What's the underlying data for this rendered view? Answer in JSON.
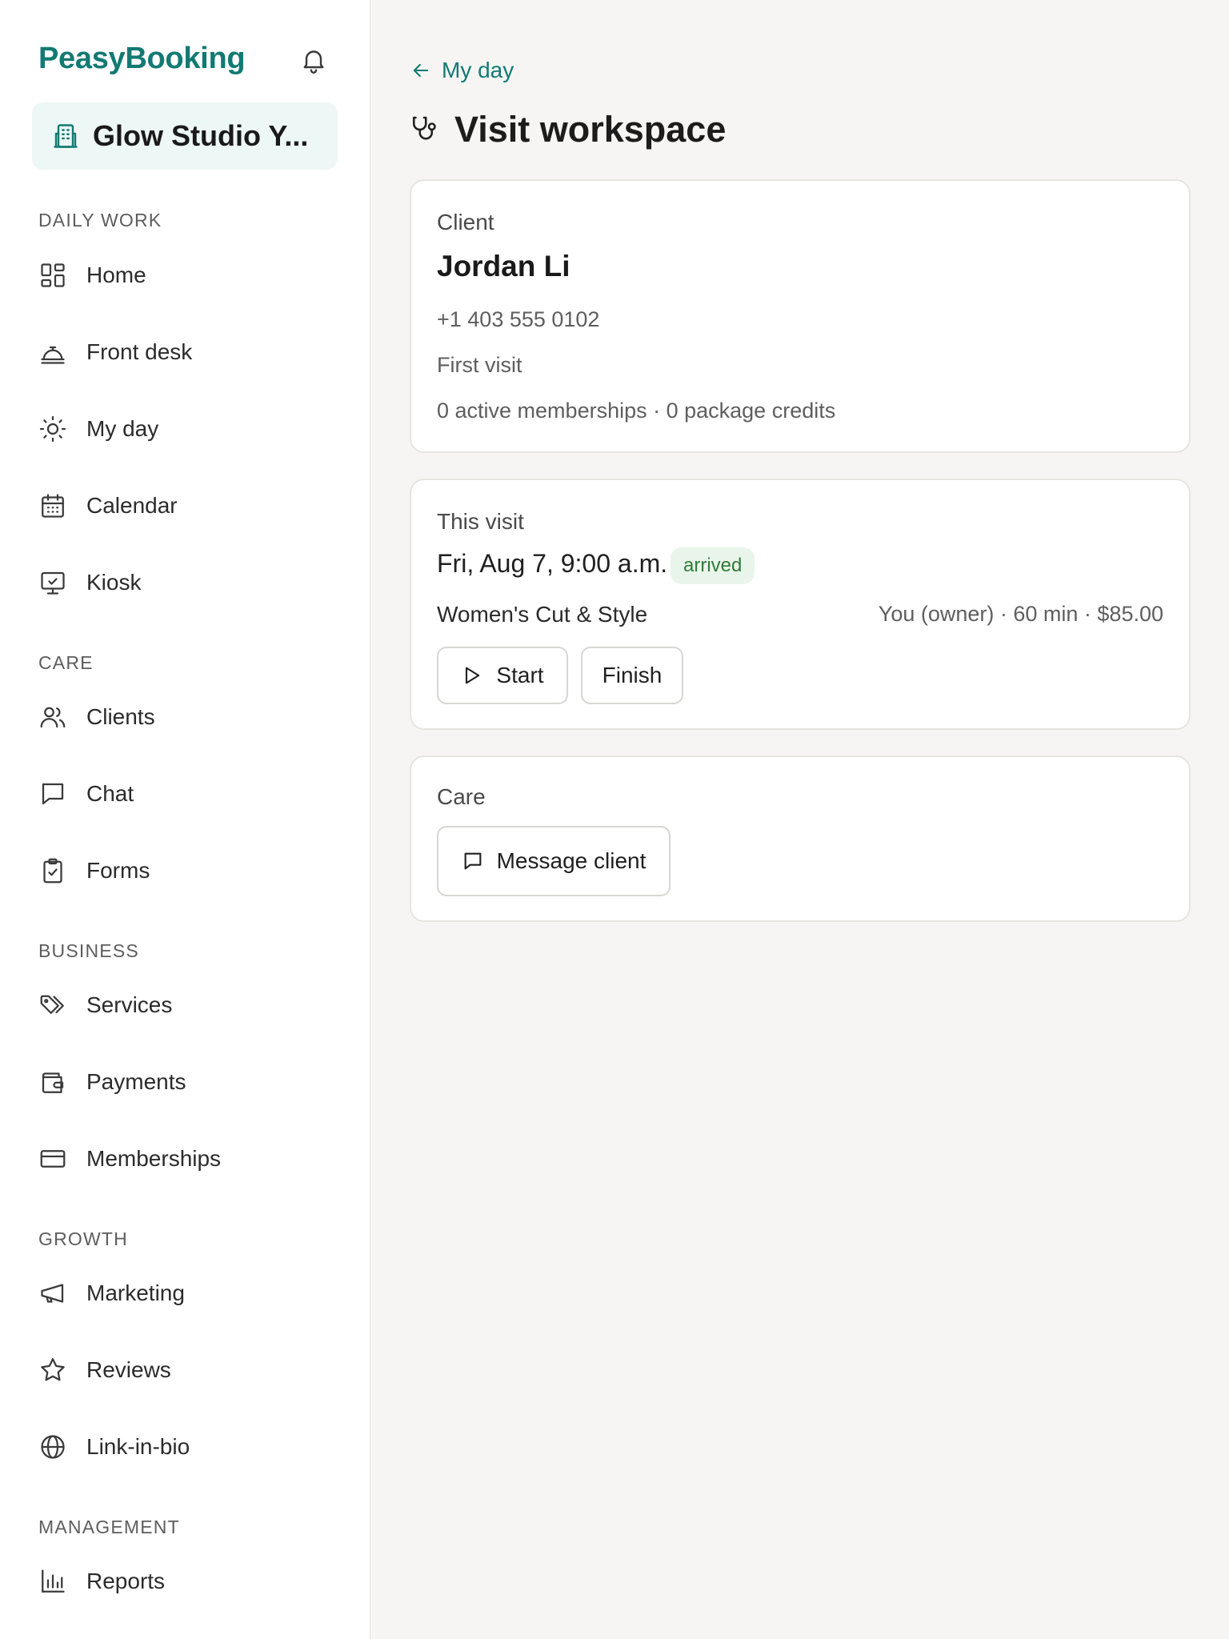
{
  "app": {
    "brand": "PeasyBooking",
    "workspace_name": "Glow Studio Y...",
    "accent_color": "#127a73"
  },
  "sidebar": {
    "sections": [
      {
        "label": "DAILY WORK",
        "items": [
          {
            "label": "Home",
            "icon": "grid-icon"
          },
          {
            "label": "Front desk",
            "icon": "service-bell-icon"
          },
          {
            "label": "My day",
            "icon": "sun-icon"
          },
          {
            "label": "Calendar",
            "icon": "calendar-icon"
          },
          {
            "label": "Kiosk",
            "icon": "monitor-icon"
          }
        ]
      },
      {
        "label": "CARE",
        "items": [
          {
            "label": "Clients",
            "icon": "users-icon"
          },
          {
            "label": "Chat",
            "icon": "chat-icon"
          },
          {
            "label": "Forms",
            "icon": "clipboard-check-icon"
          }
        ]
      },
      {
        "label": "BUSINESS",
        "items": [
          {
            "label": "Services",
            "icon": "tags-icon"
          },
          {
            "label": "Payments",
            "icon": "wallet-icon"
          },
          {
            "label": "Memberships",
            "icon": "card-icon"
          }
        ]
      },
      {
        "label": "GROWTH",
        "items": [
          {
            "label": "Marketing",
            "icon": "megaphone-icon"
          },
          {
            "label": "Reviews",
            "icon": "star-icon"
          },
          {
            "label": "Link-in-bio",
            "icon": "globe-icon"
          }
        ]
      },
      {
        "label": "MANAGEMENT",
        "items": [
          {
            "label": "Reports",
            "icon": "bar-chart-icon"
          }
        ]
      }
    ]
  },
  "main": {
    "back_label": "My day",
    "title": "Visit workspace",
    "client_card": {
      "label": "Client",
      "name": "Jordan Li",
      "phone": "+1 403 555 0102",
      "visit_status": "First visit",
      "summary": "0 active memberships · 0 package credits"
    },
    "visit_card": {
      "label": "This visit",
      "datetime": "Fri, Aug 7, 9:00 a.m.",
      "status_badge": "arrived",
      "service": "Women's Cut & Style",
      "meta": "You (owner) · 60 min · $85.00",
      "start_label": "Start",
      "finish_label": "Finish"
    },
    "care_card": {
      "label": "Care",
      "message_label": "Message client"
    }
  }
}
